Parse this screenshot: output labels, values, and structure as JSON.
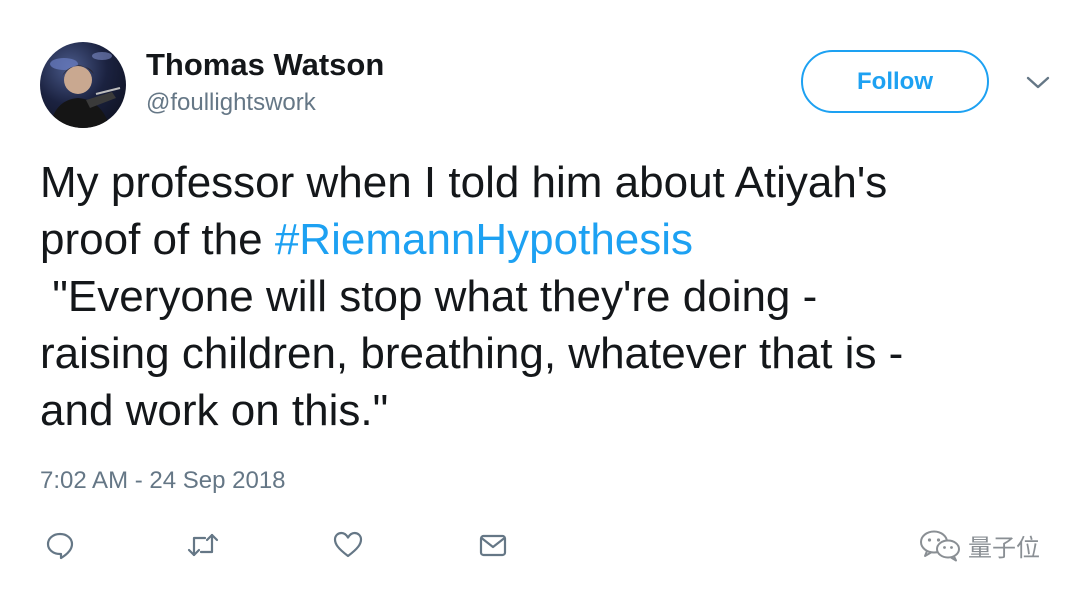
{
  "tweet": {
    "author": {
      "name": "Thomas Watson",
      "handle": "@foullightswork",
      "avatar_icon": "profile-photo"
    },
    "follow_button": {
      "label": "Follow",
      "color": "#1da1f2"
    },
    "more_menu_icon": "chevron-down-icon",
    "text_lines": [
      {
        "text": "My professor when I told him about Atiyah's"
      },
      {
        "prefix": "proof of the ",
        "hashtag": "#RiemannHypothesis"
      },
      {
        "text": " \"Everyone will stop what they're doing -"
      },
      {
        "text": "raising children, breathing, whatever that is -"
      },
      {
        "text": "and work on this.\""
      }
    ],
    "timestamp": "7:02 AM - 24 Sep 2018",
    "actions": [
      {
        "name": "reply",
        "icon": "reply-icon"
      },
      {
        "name": "retweet",
        "icon": "retweet-icon"
      },
      {
        "name": "like",
        "icon": "heart-icon"
      },
      {
        "name": "direct-message",
        "icon": "envelope-icon"
      }
    ]
  },
  "watermark": {
    "text": "量子位",
    "icon": "wechat-icon"
  },
  "colors": {
    "text": "#14171a",
    "secondary": "#657786",
    "link": "#1da1f2"
  }
}
